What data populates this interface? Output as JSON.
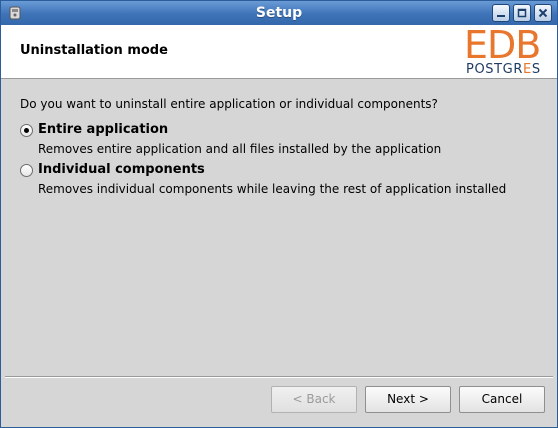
{
  "window": {
    "title": "Setup",
    "controls": [
      "minimize-icon",
      "maximize-icon",
      "close-icon"
    ]
  },
  "header": {
    "title": "Uninstallation mode",
    "logo": {
      "edb": "EDB",
      "postgres_part1": "POSTGR",
      "postgres_accent": "E",
      "postgres_part2": "S"
    }
  },
  "content": {
    "question": "Do you want to uninstall entire application or individual components?",
    "options": [
      {
        "label": "Entire application",
        "description": "Removes entire application and all files installed by the application",
        "selected": true
      },
      {
        "label": "Individual components",
        "description": "Removes individual components while leaving the rest of application installed",
        "selected": false
      }
    ]
  },
  "footer": {
    "back_label": "< Back",
    "back_enabled": false,
    "next_label": "Next >",
    "cancel_label": "Cancel"
  },
  "colors": {
    "titlebar": "#3e73b8",
    "logo_orange": "#e8762d",
    "logo_navy": "#1f3c63",
    "dialog_bg": "#d6d6d6"
  }
}
